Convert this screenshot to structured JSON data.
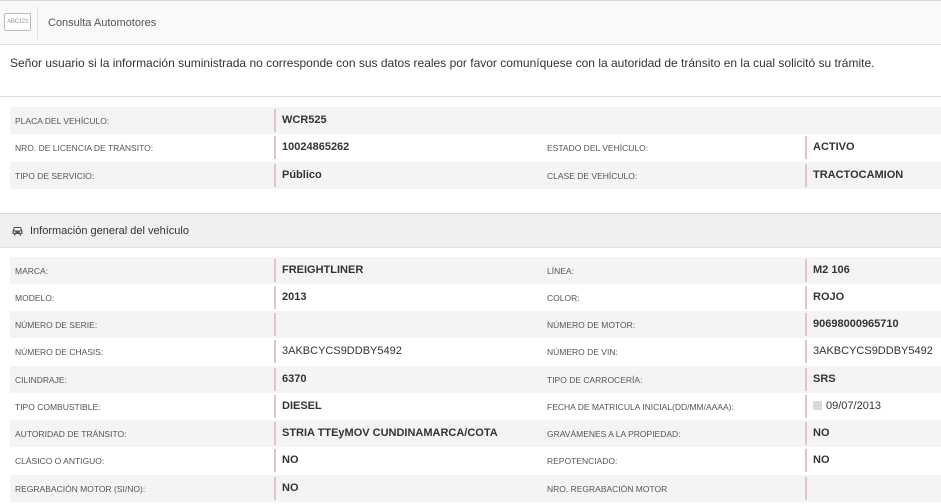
{
  "app": {
    "logo_text": "ABC123",
    "title": "Consulta Automotores"
  },
  "notice": "Señor usuario si la información suministrada no corresponde con sus datos reales por favor comuníquese con la autoridad de tránsito en la cual solicitó su trámite.",
  "summary": [
    {
      "label1": "PLACA DEL VEHÍCULO:",
      "value1": "WCR525"
    },
    {
      "label1": "NRO. DE LICENCIA DE TRÁNSITO:",
      "value1": "10024865262",
      "label2": "ESTADO DEL VEHÍCULO:",
      "value2": "ACTIVO"
    },
    {
      "label1": "TIPO DE SERVICIO:",
      "value1": "Público",
      "label2": "CLASE DE VEHÍCULO:",
      "value2": "TRACTOCAMION"
    }
  ],
  "section": {
    "title": "Información general del vehículo",
    "icon": "car-icon"
  },
  "general": [
    {
      "label1": "MARCA:",
      "value1": "FREIGHTLINER",
      "label2": "LÍNEA:",
      "value2": "M2 106"
    },
    {
      "label1": "MODELO:",
      "value1": "2013",
      "label2": "COLOR:",
      "value2": "ROJO"
    },
    {
      "label1": "NÚMERO DE SERIE:",
      "value1": "",
      "label2": "NÚMERO DE MOTOR:",
      "value2": "90698000965710"
    },
    {
      "label1": "NÚMERO DE CHASIS:",
      "value1": "3AKBCYCS9DDBY5492",
      "label2": "NÚMERO DE VIN:",
      "value2": "3AKBCYCS9DDBY5492"
    },
    {
      "label1": "CILINDRAJE:",
      "value1": "6370",
      "label2": "TIPO DE CARROCERÍA:",
      "value2": "SRS"
    },
    {
      "label1": "TIPO COMBUSTIBLE:",
      "value1": "DIESEL",
      "label2": "FECHA DE MATRICULA INICIAL(DD/MM/AAAA):",
      "value2": "09/07/2013"
    },
    {
      "label1": "AUTORIDAD DE TRÁNSITO:",
      "value1": "STRIA TTEyMOV CUNDINAMARCA/COTA",
      "label2": "GRAVÁMENES A LA PROPIEDAD:",
      "value2": "NO"
    },
    {
      "label1": "CLÁSICO O ANTIGUO:",
      "value1": "NO",
      "label2": "REPOTENCIADO:",
      "value2": "NO"
    },
    {
      "label1": "REGRABACIÓN MOTOR (SI/NO):",
      "value1": "NO",
      "label2": "NRO. REGRABACIÓN MOTOR",
      "value2": ""
    }
  ]
}
